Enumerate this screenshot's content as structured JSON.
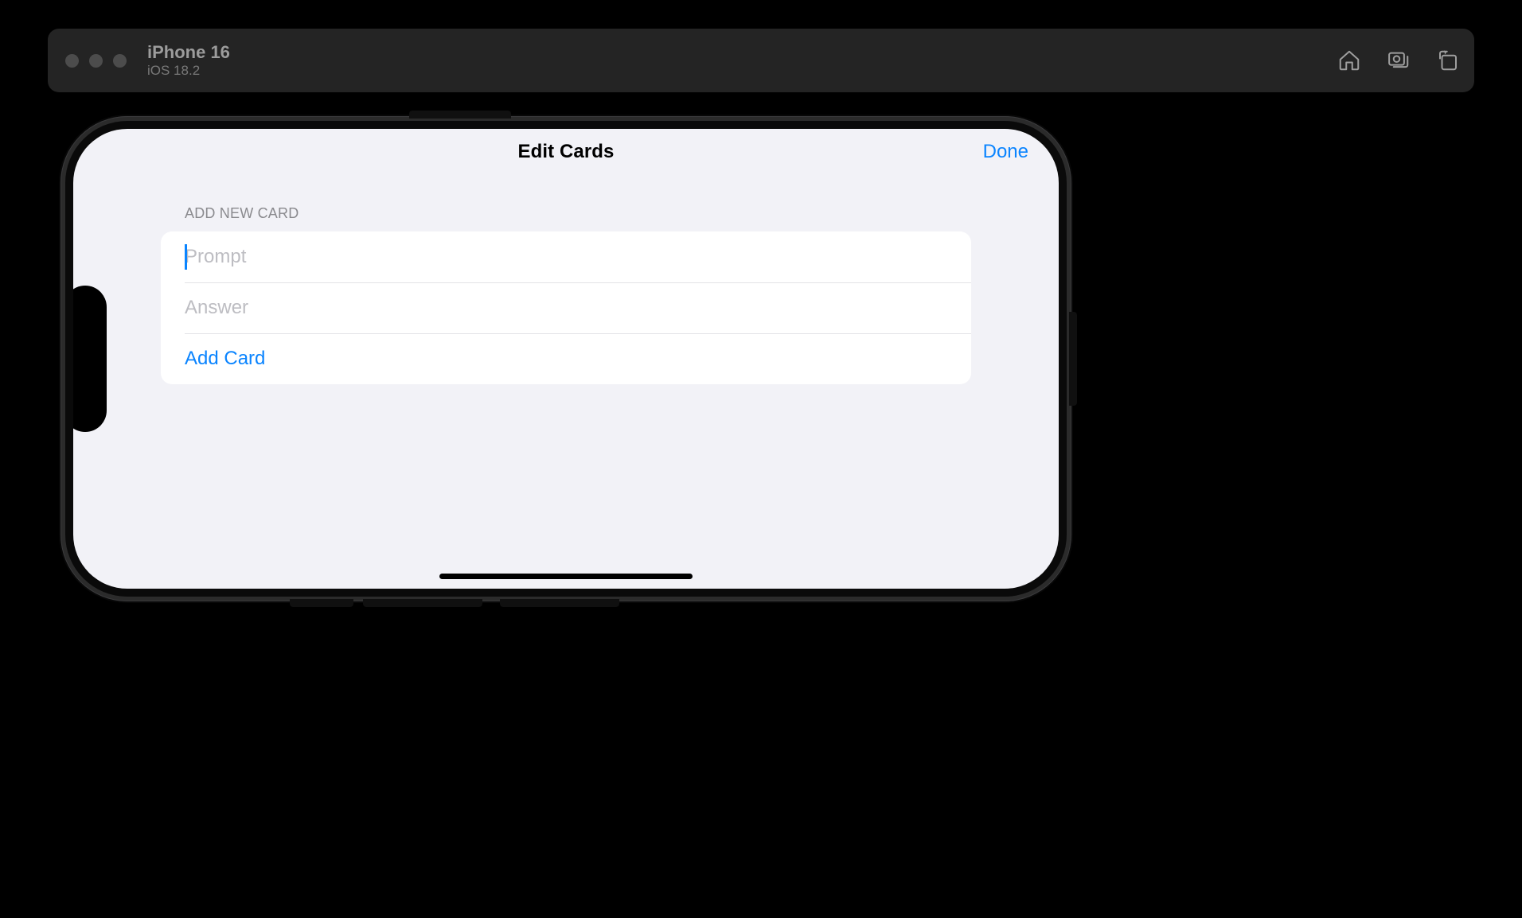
{
  "simulator": {
    "device_name": "iPhone 16",
    "os_version": "iOS 18.2"
  },
  "app": {
    "nav": {
      "title": "Edit Cards",
      "done_label": "Done"
    },
    "add_section": {
      "header": "ADD NEW CARD",
      "prompt_placeholder": "Prompt",
      "prompt_value": "",
      "answer_placeholder": "Answer",
      "answer_value": "",
      "add_button_label": "Add Card"
    }
  }
}
